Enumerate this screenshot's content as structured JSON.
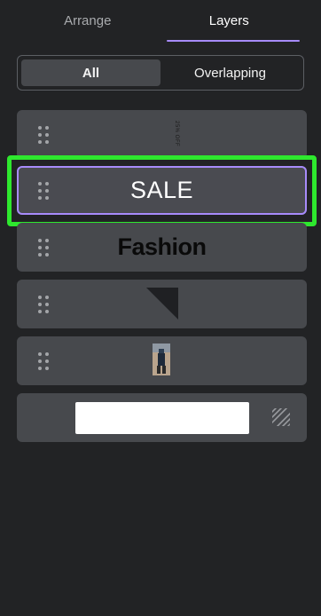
{
  "tabs": [
    {
      "label": "Arrange",
      "active": false
    },
    {
      "label": "Layers",
      "active": true
    }
  ],
  "filter": {
    "options": [
      "All",
      "Overlapping"
    ],
    "selected": "All"
  },
  "layers": [
    {
      "thumb_text": "25% OFF",
      "type": "text"
    },
    {
      "thumb_text": "SALE",
      "type": "text",
      "selected": true
    },
    {
      "thumb_text": "Fashion",
      "type": "text"
    },
    {
      "type": "shape",
      "icon": "triangle"
    },
    {
      "type": "image",
      "icon": "photo"
    },
    {
      "type": "background",
      "icon": "hatch-icon"
    }
  ],
  "colors": {
    "accent": "#a78bfa",
    "highlight": "#2ee82e",
    "panel": "#222325",
    "row": "#47494d"
  }
}
